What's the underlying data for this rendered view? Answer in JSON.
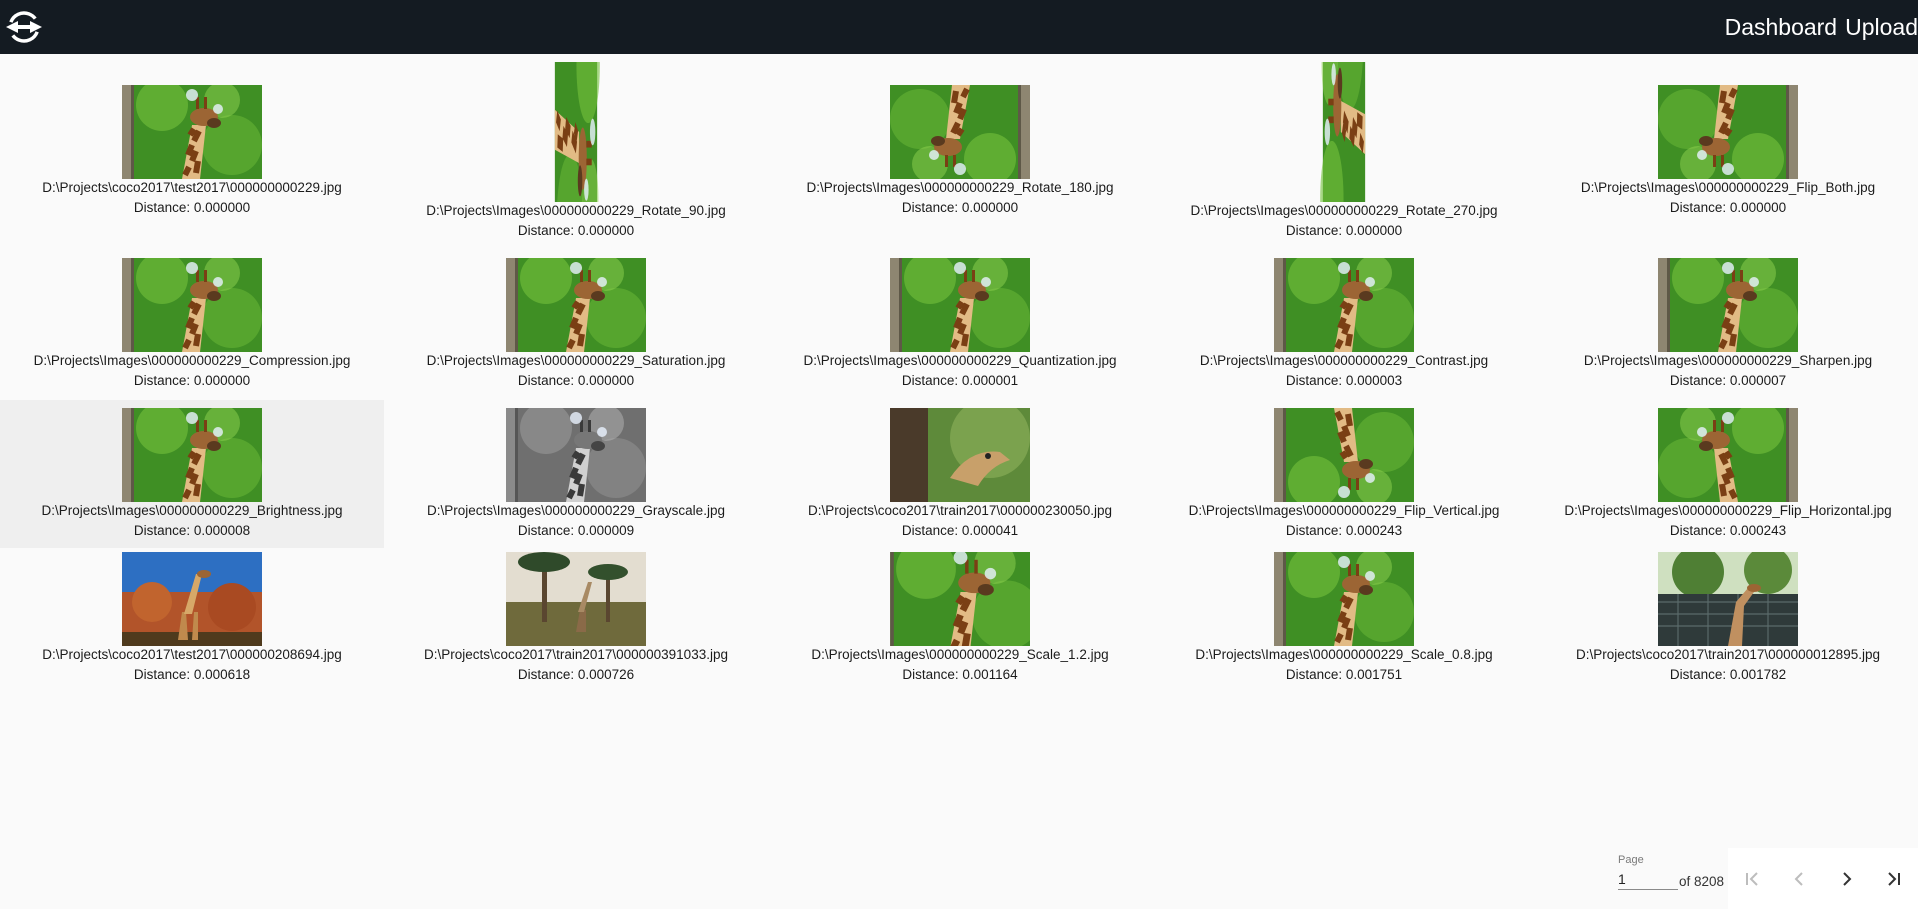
{
  "header": {
    "dashboard_label": "Dashboard",
    "upload_label": "Upload",
    "logo_icon": "swap-link-logo-icon"
  },
  "results": [
    {
      "path": "D:\\Projects\\coco2017\\test2017\\000000000229.jpg",
      "distance": "Distance: 0.000000"
    },
    {
      "path": "D:\\Projects\\Images\\000000000229_Rotate_90.jpg",
      "distance": "Distance: 0.000000"
    },
    {
      "path": "D:\\Projects\\Images\\000000000229_Rotate_180.jpg",
      "distance": "Distance: 0.000000"
    },
    {
      "path": "D:\\Projects\\Images\\000000000229_Rotate_270.jpg",
      "distance": "Distance: 0.000000"
    },
    {
      "path": "D:\\Projects\\Images\\000000000229_Flip_Both.jpg",
      "distance": "Distance: 0.000000"
    },
    {
      "path": "D:\\Projects\\Images\\000000000229_Compression.jpg",
      "distance": "Distance: 0.000000"
    },
    {
      "path": "D:\\Projects\\Images\\000000000229_Saturation.jpg",
      "distance": "Distance: 0.000000"
    },
    {
      "path": "D:\\Projects\\Images\\000000000229_Quantization.jpg",
      "distance": "Distance: 0.000001"
    },
    {
      "path": "D:\\Projects\\Images\\000000000229_Contrast.jpg",
      "distance": "Distance: 0.000003"
    },
    {
      "path": "D:\\Projects\\Images\\000000000229_Sharpen.jpg",
      "distance": "Distance: 0.000007"
    },
    {
      "path": "D:\\Projects\\Images\\000000000229_Brightness.jpg",
      "distance": "Distance: 0.000008"
    },
    {
      "path": "D:\\Projects\\Images\\000000000229_Grayscale.jpg",
      "distance": "Distance: 0.000009"
    },
    {
      "path": "D:\\Projects\\coco2017\\train2017\\000000230050.jpg",
      "distance": "Distance: 0.000041"
    },
    {
      "path": "D:\\Projects\\Images\\000000000229_Flip_Vertical.jpg",
      "distance": "Distance: 0.000243"
    },
    {
      "path": "D:\\Projects\\Images\\000000000229_Flip_Horizontal.jpg",
      "distance": "Distance: 0.000243"
    },
    {
      "path": "D:\\Projects\\coco2017\\test2017\\000000208694.jpg",
      "distance": "Distance: 0.000618"
    },
    {
      "path": "D:\\Projects\\coco2017\\train2017\\000000391033.jpg",
      "distance": "Distance: 0.000726"
    },
    {
      "path": "D:\\Projects\\Images\\000000000229_Scale_1.2.jpg",
      "distance": "Distance: 0.001164"
    },
    {
      "path": "D:\\Projects\\Images\\000000000229_Scale_0.8.jpg",
      "distance": "Distance: 0.001751"
    },
    {
      "path": "D:\\Projects\\coco2017\\train2017\\000000012895.jpg",
      "distance": "Distance: 0.001782"
    }
  ],
  "pager": {
    "label": "Page",
    "value": "1",
    "of_text": "of 8208",
    "first_icon": "first-page-icon",
    "prev_icon": "chevron-left-icon",
    "next_icon": "chevron-right-icon",
    "last_icon": "last-page-icon"
  }
}
